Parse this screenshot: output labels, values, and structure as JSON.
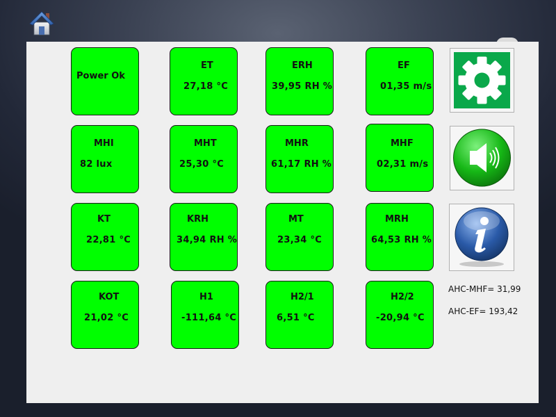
{
  "tiles": [
    {
      "label": "Power Ok",
      "value": ""
    },
    {
      "label": "ET",
      "value": "27,18 °C"
    },
    {
      "label": "ERH",
      "value": "39,95 RH %"
    },
    {
      "label": "EF",
      "value": "01,35 m/s"
    },
    {
      "label": "MHI",
      "value": "82 lux"
    },
    {
      "label": "MHT",
      "value": "25,30 °C"
    },
    {
      "label": "MHR",
      "value": "61,17 RH %"
    },
    {
      "label": "MHF",
      "value": "02,31 m/s"
    },
    {
      "label": "KT",
      "value": "22,81 °C"
    },
    {
      "label": "KRH",
      "value": "34,94 RH %"
    },
    {
      "label": "MT",
      "value": "23,34 °C"
    },
    {
      "label": "MRH",
      "value": "64,53 RH %"
    },
    {
      "label": "KOT",
      "value": "21,02 °C"
    },
    {
      "label": "H1",
      "value": "-111,64 °C"
    },
    {
      "label": "H2/1",
      "value": "6,51 °C"
    },
    {
      "label": "H2/2",
      "value": "-20,94 °C"
    }
  ],
  "side": {
    "ahc_mhf": "AHC-MHF= 31,99",
    "ahc_ef": "AHC-EF= 193,42"
  },
  "icons": {
    "home": "home-icon",
    "settings": "gear-icon",
    "sound": "speaker-icon",
    "info": "info-icon"
  },
  "colors": {
    "tile_bg": "#00ff00",
    "panel_bg": "#efefef"
  }
}
